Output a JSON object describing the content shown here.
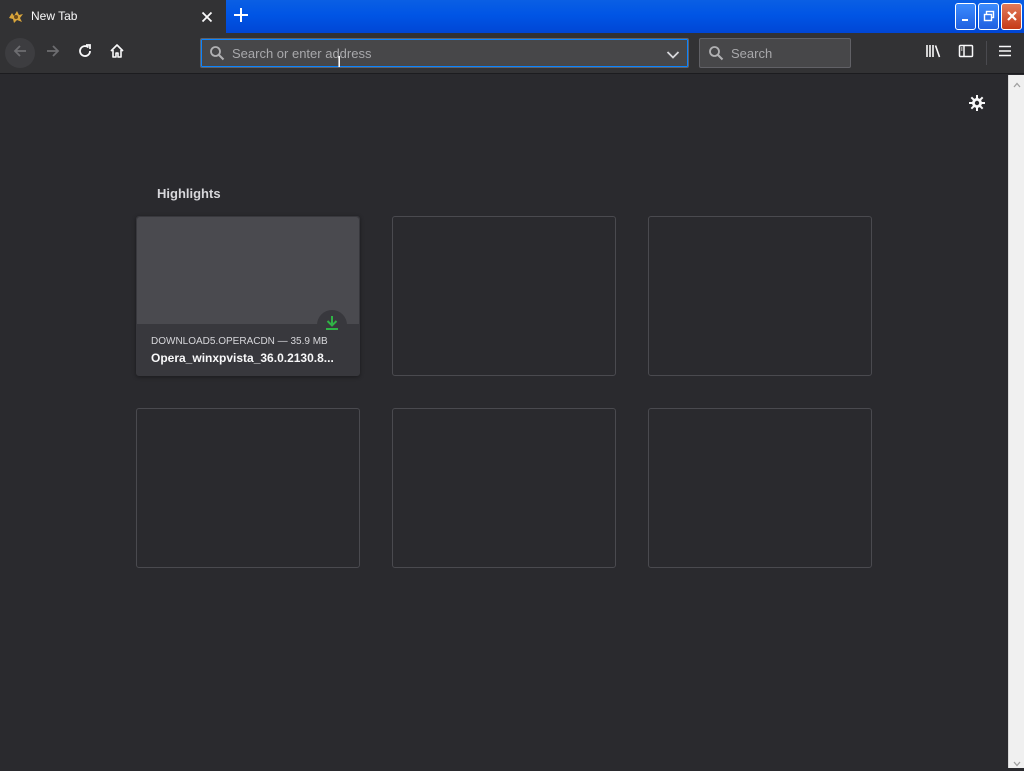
{
  "browser": {
    "tab": {
      "title": "New Tab",
      "favicon": "firefox-favicon-icon"
    },
    "new_tab_icon": "plus-icon",
    "window_controls": [
      "minimize-icon",
      "restore-icon",
      "close-icon"
    ]
  },
  "toolbar": {
    "back_icon": "back-arrow-icon",
    "forward_icon": "forward-arrow-icon",
    "reload_icon": "reload-icon",
    "home_icon": "home-icon",
    "url": {
      "value": "",
      "placeholder": "Search or enter address"
    },
    "search": {
      "value": "",
      "placeholder": "Search"
    },
    "library_icon": "library-icon",
    "sidebar_icon": "sidebar-icon",
    "menu_icon": "hamburger-menu-icon"
  },
  "newtab": {
    "settings_icon": "gear-icon",
    "highlights": {
      "title": "Highlights",
      "cards": [
        {
          "host": "DOWNLOAD5.OPERACDN — 35.9 MB",
          "title": "Opera_winxpvista_36.0.2130.8...",
          "badge_icon": "download-icon"
        }
      ]
    }
  },
  "colors": {
    "background": "#2a2a2e",
    "toolbar": "#323234",
    "titlebar_blue": "#0055e5",
    "accent_focus": "#0a84ff",
    "download_green": "#30b346"
  }
}
